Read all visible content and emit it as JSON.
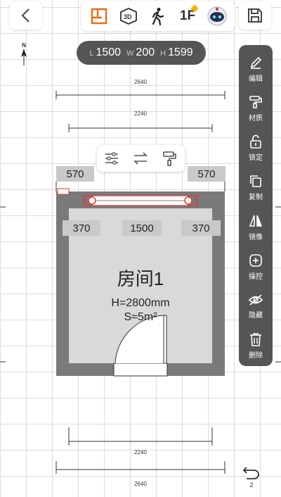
{
  "toolbar": {
    "floor_label": "1F"
  },
  "dimensions_pill": {
    "l_key": "L",
    "l_val": "1500",
    "w_key": "W",
    "w_val": "200",
    "h_key": "H",
    "h_val": "1599"
  },
  "compass": {
    "n": "N"
  },
  "side_panel": {
    "items": [
      {
        "label": "编辑",
        "icon": "pencil-icon"
      },
      {
        "label": "材质",
        "icon": "paint-roller-icon"
      },
      {
        "label": "锁定",
        "icon": "lock-icon"
      },
      {
        "label": "复制",
        "icon": "copy-icon"
      },
      {
        "label": "镜像",
        "icon": "mirror-icon"
      },
      {
        "label": "操控",
        "icon": "control-plus-icon"
      },
      {
        "label": "隐藏",
        "icon": "eye-off-icon"
      },
      {
        "label": "删除",
        "icon": "trash-icon"
      }
    ]
  },
  "plan": {
    "outer_top": "2640",
    "inner_top": "2240",
    "inner_bottom": "2240",
    "outer_bottom": "2640",
    "left_box": "570",
    "right_box": "570",
    "win_left": "370",
    "win_mid": "1500",
    "win_right": "370",
    "room_name": "房间1",
    "room_height": "H=2800mm",
    "room_area": "S≈5m²"
  },
  "undo": {
    "count": "2"
  },
  "colors": {
    "wall": "#7a7a7a",
    "floor": "#d9d9d9",
    "panel": "#555555",
    "accent": "#e53935"
  }
}
